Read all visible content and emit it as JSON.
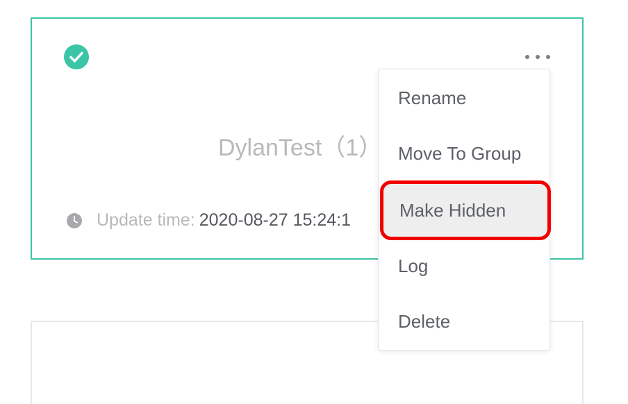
{
  "card": {
    "title": "DylanTest（1）",
    "update_label": "Update time:",
    "update_value": "2020-08-27 15:24:1"
  },
  "icons": {
    "status": "check-circle-icon",
    "more": "more-horizontal-icon",
    "time": "clock-icon"
  },
  "menu": {
    "items": [
      {
        "label": "Rename"
      },
      {
        "label": "Move To Group"
      },
      {
        "label": "Make Hidden",
        "highlighted": true
      },
      {
        "label": "Log"
      },
      {
        "label": "Delete"
      }
    ]
  },
  "colors": {
    "accent": "#3cc4a7",
    "highlight_border": "#f20000",
    "muted_text": "#b8b9bc",
    "body_text": "#55585e"
  }
}
